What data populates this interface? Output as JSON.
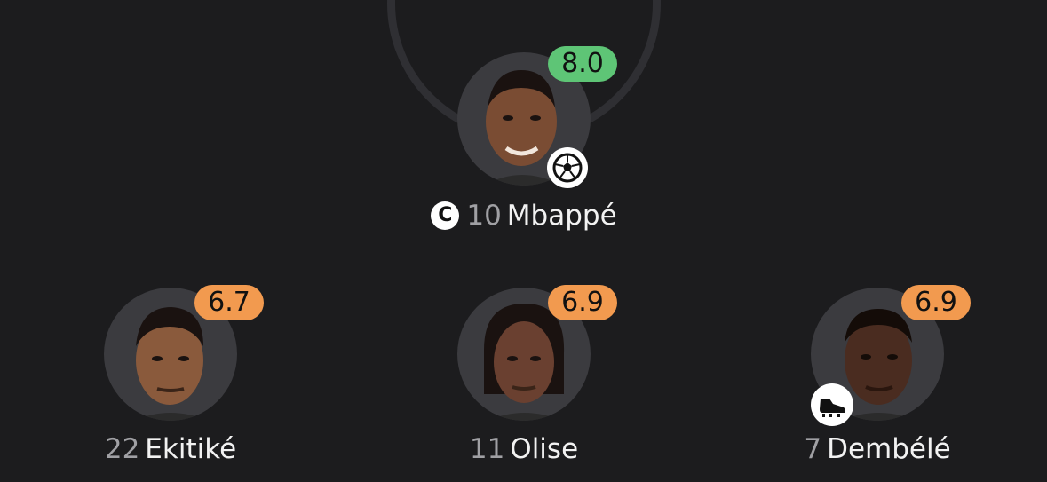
{
  "players": [
    {
      "id": "mbappe",
      "number": "10",
      "name": "Mbappé",
      "rating": "8.0",
      "rating_color": "#5ec576",
      "captain": true,
      "captain_label": "C",
      "event": "goal-ball-icon"
    },
    {
      "id": "ekitike",
      "number": "22",
      "name": "Ekitiké",
      "rating": "6.7",
      "rating_color": "#f29a4f"
    },
    {
      "id": "olise",
      "number": "11",
      "name": "Olise",
      "rating": "6.9",
      "rating_color": "#f29a4f"
    },
    {
      "id": "dembele",
      "number": "7",
      "name": "Dembélé",
      "rating": "6.9",
      "rating_color": "#f29a4f",
      "event": "boot-assist-icon"
    }
  ],
  "colors": {
    "background": "#1c1c1e",
    "avatar_bg": "#3b3b3f",
    "number_text": "#a0a0a4"
  }
}
